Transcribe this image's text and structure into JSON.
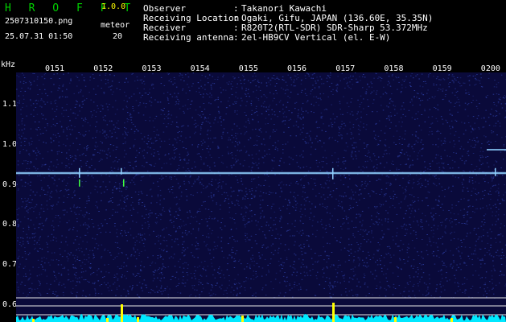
{
  "header": {
    "app_title": "H R O F F T",
    "version": "1.0.0",
    "filename": "2507310150.png",
    "datetime": "25.07.31 01:50",
    "meteor_label": "meteor",
    "meteor_count": "20"
  },
  "info": [
    {
      "key": "Observer",
      "value": "Takanori Kawachi"
    },
    {
      "key": "Receiving Location",
      "value": "Ogaki, Gifu, JAPAN (136.60E, 35.35N)"
    },
    {
      "key": "Receiver",
      "value": "R820T2(RTL-SDR) SDR-Sharp 53.372MHz"
    },
    {
      "key": "Receiving antenna",
      "value": "2el-HB9CV Vertical (el. E-W)"
    }
  ],
  "colon": ":",
  "colors": {
    "title": "#00d000",
    "version": "#ffff00",
    "text": "#ffffff",
    "axis_text": "#ffffff",
    "spectrogram_bg": "#0a0a3a",
    "noise": "#2a3a9a",
    "echo_line": "#8fd0ff",
    "guide_lines": "#e8e8e8",
    "power_cyan": "#00e8ff",
    "power_yellow": "#ffff00"
  },
  "chart_data": {
    "type": "heatmap",
    "ylabel": "kHz",
    "y_ticks": [
      "1.1",
      "1.0",
      "0.9",
      "0.8",
      "0.7",
      "0.6"
    ],
    "x_ticks": [
      "0151",
      "0152",
      "0153",
      "0154",
      "0155",
      "0156",
      "0157",
      "0158",
      "0159",
      "0200"
    ],
    "echo_frequency_khz": 0.93,
    "ylim": [
      0.58,
      1.19
    ]
  }
}
